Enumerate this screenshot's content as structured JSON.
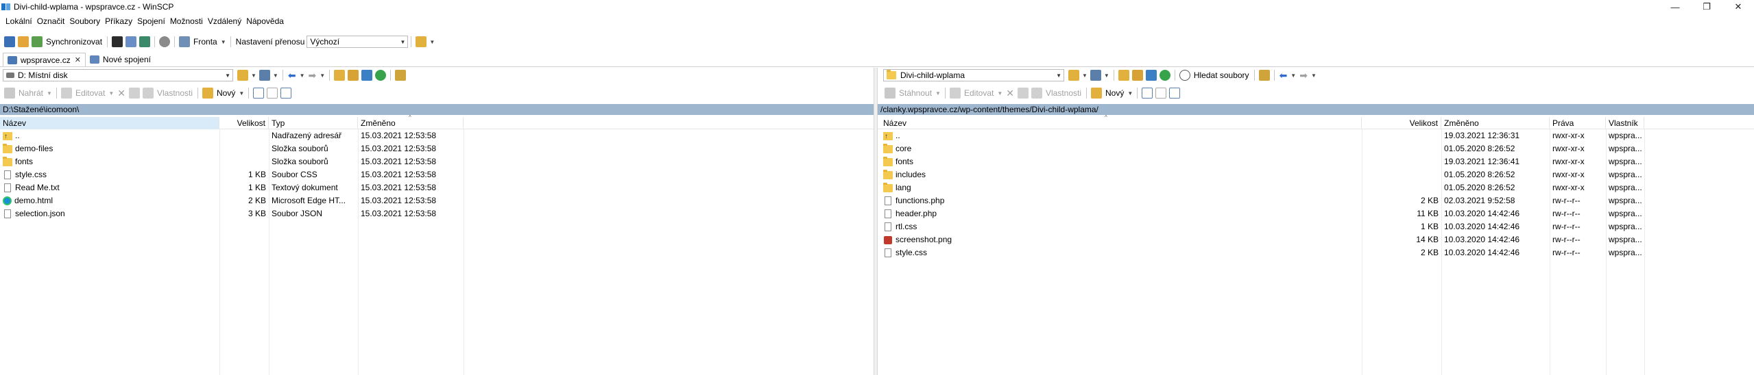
{
  "window": {
    "title": "Divi-child-wplama - wpspravce.cz - WinSCP",
    "minimize": "—",
    "maximize": "❐",
    "close": "✕"
  },
  "menu": [
    "Lokální",
    "Označit",
    "Soubory",
    "Příkazy",
    "Spojení",
    "Možnosti",
    "Vzdálený",
    "Nápověda"
  ],
  "toolbar": {
    "sync_label": "Synchronizovat",
    "queue_label": "Fronta",
    "transfer_label": "Nastavení přenosu",
    "transfer_value": "Výchozí"
  },
  "tabs": {
    "session_label": "wpspravce.cz",
    "new_label": "Nové spojení"
  },
  "left": {
    "drive": "D: Místní disk",
    "actions": {
      "upload": "Nahrát",
      "edit": "Editovat",
      "properties": "Vlastnosti",
      "new": "Nový"
    },
    "path": "D:\\Stažené\\icomoon\\",
    "headers": {
      "name": "Název",
      "size": "Velikost",
      "type": "Typ",
      "changed": "Změněno"
    },
    "rows": [
      {
        "name": "..",
        "size": "",
        "type": "Nadřazený adresář",
        "changed": "15.03.2021   12:53:58",
        "icon": "up"
      },
      {
        "name": "demo-files",
        "size": "",
        "type": "Složka souborů",
        "changed": "15.03.2021   12:53:58",
        "icon": "folder"
      },
      {
        "name": "fonts",
        "size": "",
        "type": "Složka souborů",
        "changed": "15.03.2021   12:53:58",
        "icon": "folder"
      },
      {
        "name": "style.css",
        "size": "1 KB",
        "type": "Soubor CSS",
        "changed": "15.03.2021   12:53:58",
        "icon": "doc"
      },
      {
        "name": "Read Me.txt",
        "size": "1 KB",
        "type": "Textový dokument",
        "changed": "15.03.2021   12:53:58",
        "icon": "doc"
      },
      {
        "name": "demo.html",
        "size": "2 KB",
        "type": "Microsoft Edge HT...",
        "changed": "15.03.2021   12:53:58",
        "icon": "edge"
      },
      {
        "name": "selection.json",
        "size": "3 KB",
        "type": "Soubor JSON",
        "changed": "15.03.2021   12:53:58",
        "icon": "doc"
      }
    ]
  },
  "right": {
    "folder": "Divi-child-wplama",
    "find_label": "Hledat soubory",
    "actions": {
      "download": "Stáhnout",
      "edit": "Editovat",
      "properties": "Vlastnosti",
      "new": "Nový"
    },
    "path": "/clanky.wpspravce.cz/wp-content/themes/Divi-child-wplama/",
    "headers": {
      "name": "Název",
      "size": "Velikost",
      "changed": "Změněno",
      "rights": "Práva",
      "owner": "Vlastník"
    },
    "rows": [
      {
        "name": "..",
        "size": "",
        "changed": "19.03.2021 12:36:31",
        "rights": "rwxr-xr-x",
        "owner": "wpspra...",
        "icon": "up"
      },
      {
        "name": "core",
        "size": "",
        "changed": "01.05.2020 8:26:52",
        "rights": "rwxr-xr-x",
        "owner": "wpspra...",
        "icon": "folder"
      },
      {
        "name": "fonts",
        "size": "",
        "changed": "19.03.2021 12:36:41",
        "rights": "rwxr-xr-x",
        "owner": "wpspra...",
        "icon": "folder"
      },
      {
        "name": "includes",
        "size": "",
        "changed": "01.05.2020 8:26:52",
        "rights": "rwxr-xr-x",
        "owner": "wpspra...",
        "icon": "folder"
      },
      {
        "name": "lang",
        "size": "",
        "changed": "01.05.2020 8:26:52",
        "rights": "rwxr-xr-x",
        "owner": "wpspra...",
        "icon": "folder"
      },
      {
        "name": "functions.php",
        "size": "2 KB",
        "changed": "02.03.2021 9:52:58",
        "rights": "rw-r--r--",
        "owner": "wpspra...",
        "icon": "doc"
      },
      {
        "name": "header.php",
        "size": "11 KB",
        "changed": "10.03.2020 14:42:46",
        "rights": "rw-r--r--",
        "owner": "wpspra...",
        "icon": "doc"
      },
      {
        "name": "rtl.css",
        "size": "1 KB",
        "changed": "10.03.2020 14:42:46",
        "rights": "rw-r--r--",
        "owner": "wpspra...",
        "icon": "doc"
      },
      {
        "name": "screenshot.png",
        "size": "14 KB",
        "changed": "10.03.2020 14:42:46",
        "rights": "rw-r--r--",
        "owner": "wpspra...",
        "icon": "image"
      },
      {
        "name": "style.css",
        "size": "2 KB",
        "changed": "10.03.2020 14:42:46",
        "rights": "rw-r--r--",
        "owner": "wpspra...",
        "icon": "doc"
      }
    ]
  }
}
